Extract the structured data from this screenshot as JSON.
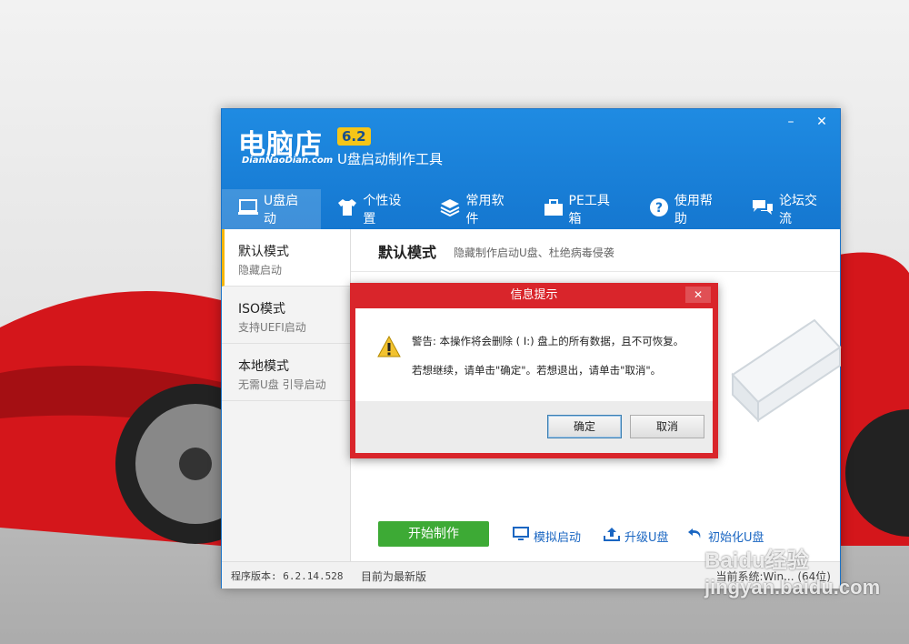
{
  "app": {
    "logo": "电脑店",
    "logo_subtitle": "DianNaoDian.com",
    "version": "6.2",
    "title": "U盘启动制作工具",
    "window_controls": {
      "minimize": "–",
      "close": "✕"
    }
  },
  "tabs": [
    {
      "label": "U盘启动",
      "icon": "usb-icon"
    },
    {
      "label": "个性设置",
      "icon": "shirt-icon"
    },
    {
      "label": "常用软件",
      "icon": "stack-icon"
    },
    {
      "label": "PE工具箱",
      "icon": "toolbox-icon"
    },
    {
      "label": "使用帮助",
      "icon": "help-icon"
    },
    {
      "label": "论坛交流",
      "icon": "chat-icon"
    }
  ],
  "sidebar": {
    "items": [
      {
        "title": "默认模式",
        "desc": "隐藏启动"
      },
      {
        "title": "ISO模式",
        "desc": "支持UEFI启动"
      },
      {
        "title": "本地模式",
        "desc": "无需U盘 引导启动"
      }
    ]
  },
  "main": {
    "mode_title": "默认模式",
    "mode_desc": "隐藏制作启动U盘、杜绝病毒侵袭"
  },
  "actions": {
    "start": "开始制作",
    "simulate": "模拟启动",
    "upgrade": "升级U盘",
    "init": "初始化U盘"
  },
  "status": {
    "version_label": "程序版本: 6.2.14.528",
    "latest": "目前为最新版",
    "system": "当前系统:Win... (64位)"
  },
  "dialog": {
    "title": "信息提示",
    "close": "✕",
    "message1": "警告: 本操作将会删除 ( I:) 盘上的所有数据，且不可恢复。",
    "message2": "若想继续，请单击\"确定\"。若想退出，请单击\"取消\"。",
    "ok": "确定",
    "cancel": "取消"
  },
  "watermark": {
    "line1": "Baidu经验",
    "line2": "jingyan.baidu.com"
  },
  "colors": {
    "title_blue": "#1f8be2",
    "dialog_red": "#d9252b",
    "start_green": "#3daa35",
    "accent_yellow": "#f5b400"
  }
}
